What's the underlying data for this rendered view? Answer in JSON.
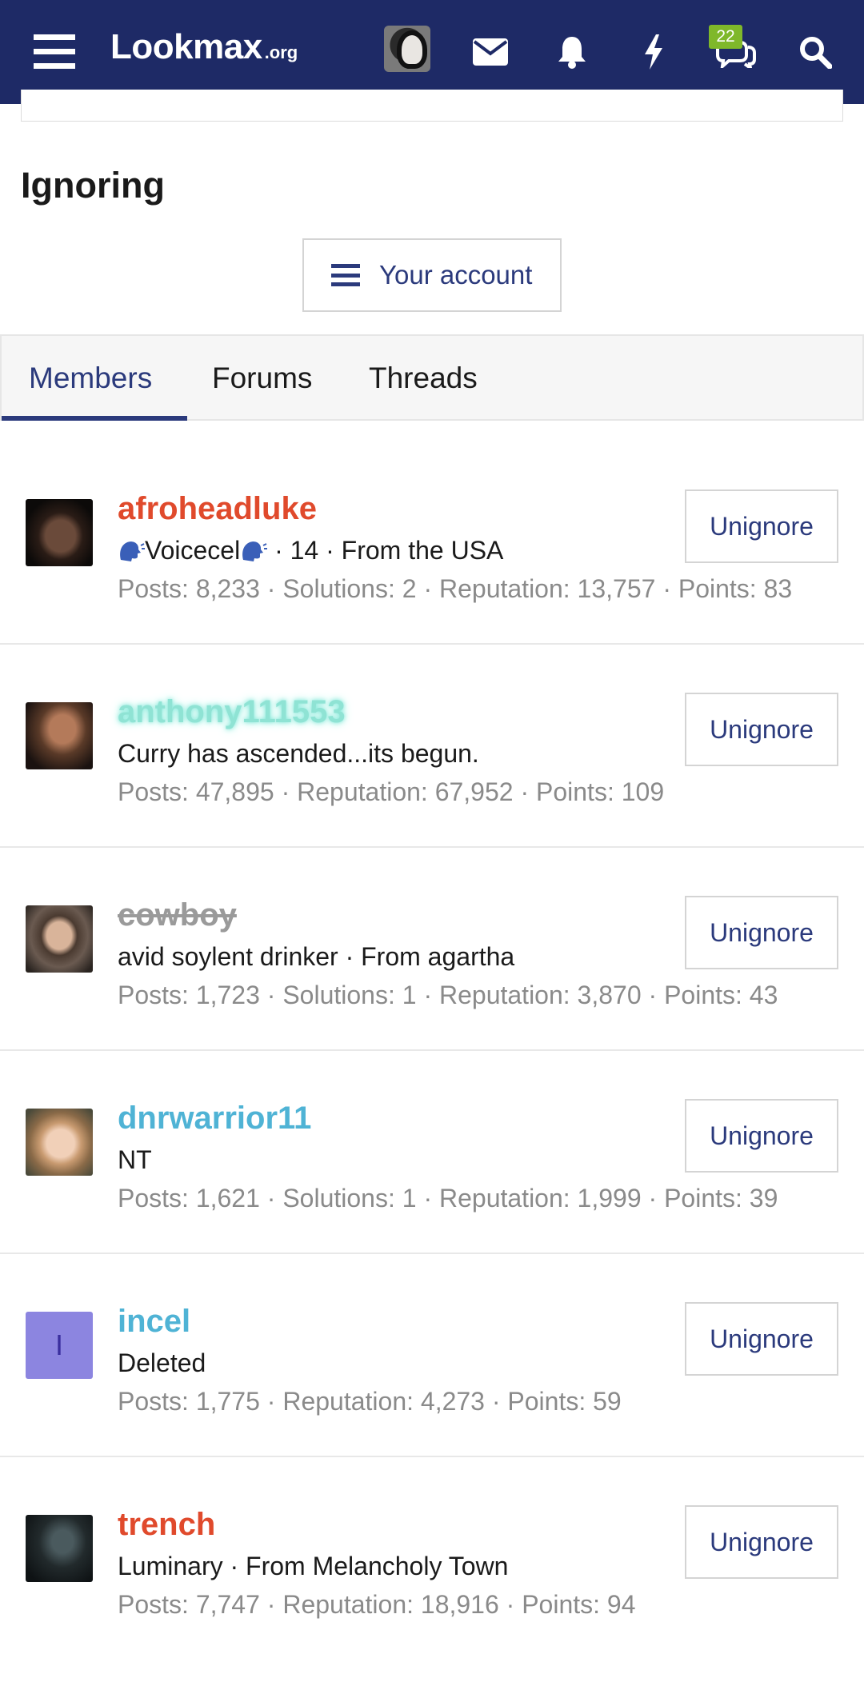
{
  "header": {
    "logo_main": "Lookmax",
    "logo_tld": ".org",
    "conversations_badge": "22",
    "icons": [
      "menu-icon",
      "user-avatar",
      "envelope-icon",
      "bell-icon",
      "lightning-icon",
      "conversations-icon",
      "search-icon"
    ],
    "colors": {
      "bar": "#1e2a66",
      "badge": "#7fb82a"
    }
  },
  "page": {
    "title": "Ignoring",
    "account_button": "Your account"
  },
  "tabs": [
    {
      "label": "Members",
      "active": true
    },
    {
      "label": "Forums",
      "active": false
    },
    {
      "label": "Threads",
      "active": false
    }
  ],
  "members": [
    {
      "name": "afroheadluke",
      "title": "Voicecel",
      "meta": " · 14 · From the USA",
      "stats": "Posts: 8,233 · Solutions: 2 · Reputation: 13,757 · Points: 83",
      "action": "Unignore"
    },
    {
      "name": "anthony111553",
      "title": "Curry has ascended...its begun.",
      "stats": "Posts: 47,895 · Reputation: 67,952 · Points: 109",
      "action": "Unignore"
    },
    {
      "name": "cowboy",
      "title": "avid soylent drinker · From agartha",
      "stats": "Posts: 1,723 · Solutions: 1 · Reputation: 3,870 · Points: 43",
      "action": "Unignore"
    },
    {
      "name": "dnrwarrior11",
      "title": "NT",
      "stats": "Posts: 1,621 · Solutions: 1 · Reputation: 1,999 · Points: 39",
      "action": "Unignore"
    },
    {
      "name": "incel",
      "avatar_letter": "I",
      "title": "Deleted",
      "stats": "Posts: 1,775 · Reputation: 4,273 · Points: 59",
      "action": "Unignore"
    },
    {
      "name": "trench",
      "title": "Luminary · From Melancholy Town",
      "stats": "Posts: 7,747 · Reputation: 18,916 · Points: 94",
      "action": "Unignore"
    }
  ]
}
